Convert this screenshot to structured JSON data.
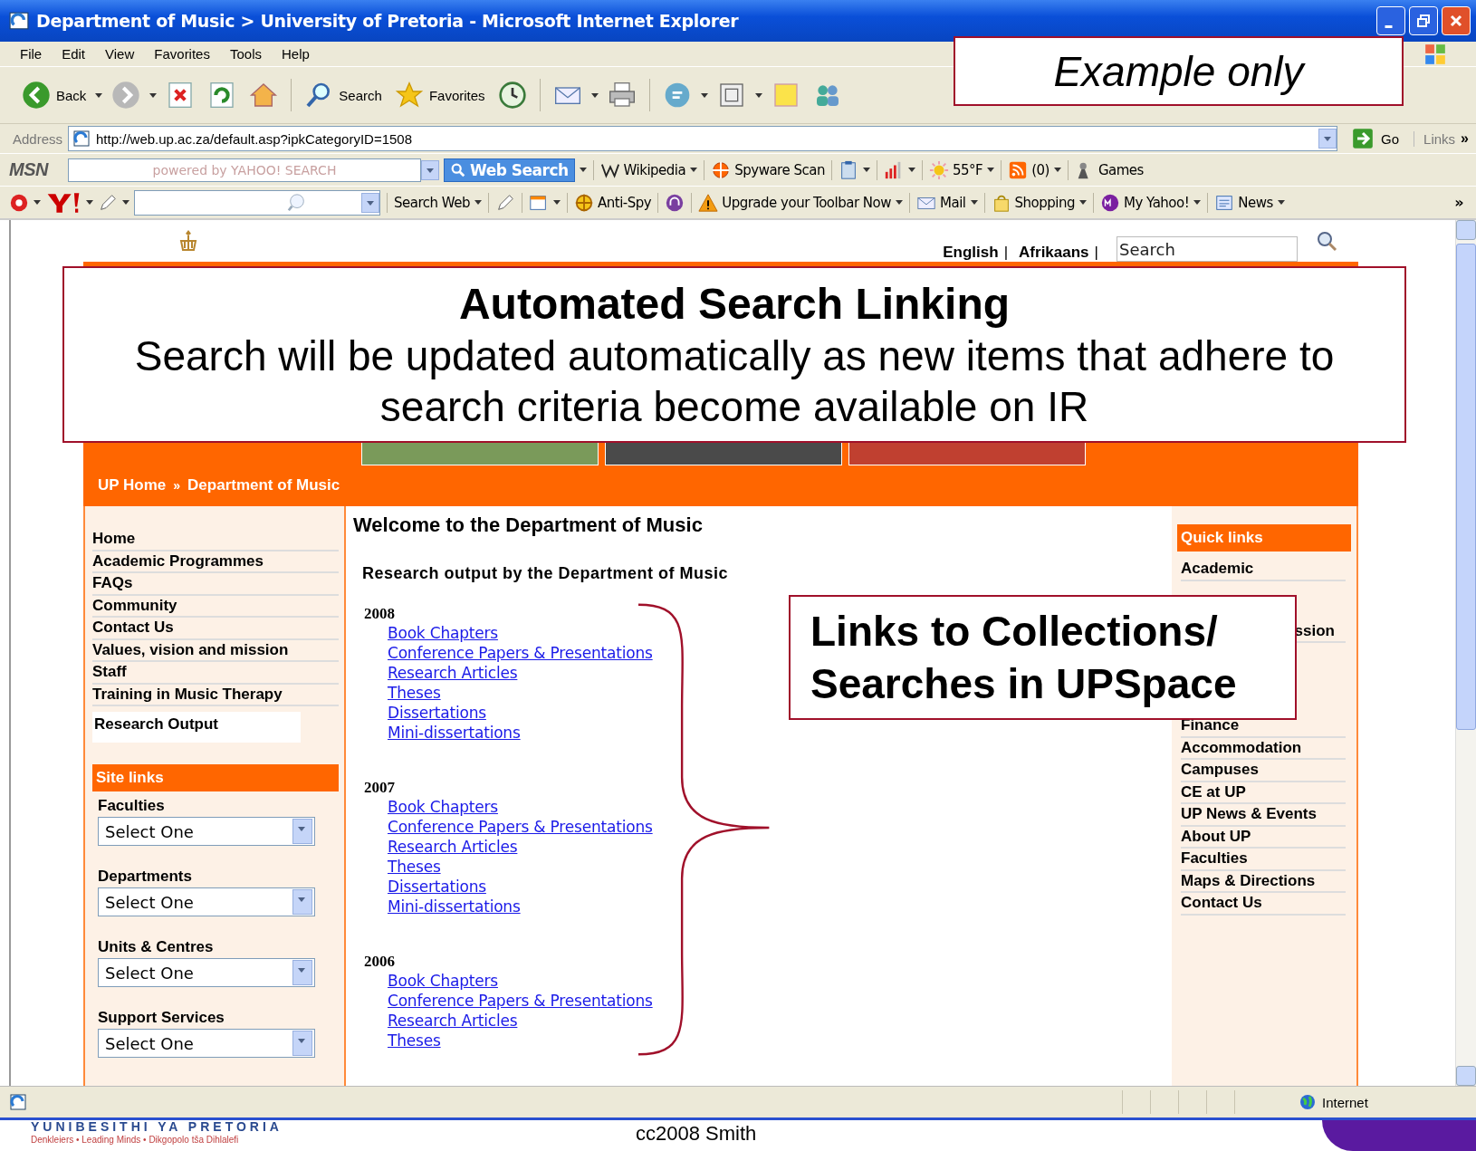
{
  "window": {
    "title": "Department of Music > University of Pretoria - Microsoft Internet Explorer"
  },
  "menu": [
    "File",
    "Edit",
    "View",
    "Favorites",
    "Tools",
    "Help"
  ],
  "toolbar": [
    {
      "kind": "back",
      "label": "Back",
      "dropdown": true
    },
    {
      "kind": "forward",
      "dropdown": true
    },
    {
      "kind": "stop"
    },
    {
      "kind": "refresh"
    },
    {
      "kind": "home"
    },
    {
      "kind": "search",
      "label": "Search"
    },
    {
      "kind": "favorites",
      "label": "Favorites"
    },
    {
      "kind": "history"
    },
    {
      "kind": "mail",
      "dropdown": true
    },
    {
      "kind": "print"
    },
    {
      "kind": "messenger",
      "dropdown": true
    },
    {
      "kind": "window",
      "dropdown": true
    },
    {
      "kind": "note"
    },
    {
      "kind": "people"
    }
  ],
  "address": {
    "label": "Address",
    "value": "http://web.up.ac.za/default.asp?ipkCategoryID=1508",
    "go": "Go",
    "links": "Links",
    "more": "»"
  },
  "msn_bar": {
    "logo": "MSN",
    "placeholder": "powered by YAHOO! SEARCH",
    "search_button": "Web Search",
    "items": [
      {
        "kind": "wiki",
        "label": "Wikipedia",
        "dropdown": true
      },
      {
        "kind": "spyware",
        "label": "Spyware Scan",
        "dropdown": false
      },
      {
        "kind": "clip",
        "dropdown": true
      },
      {
        "kind": "signal",
        "dropdown": true
      },
      {
        "kind": "weather",
        "label": "55°F",
        "dropdown": true
      },
      {
        "kind": "rss",
        "label": "(0)",
        "dropdown": true
      },
      {
        "kind": "games",
        "label": "Games",
        "dropdown": false
      }
    ]
  },
  "yahoo_bar": {
    "search_label": "Search Web",
    "items": [
      {
        "kind": "pencil",
        "dropdown": false
      },
      {
        "kind": "form",
        "dropdown": true
      },
      {
        "kind": "antispy",
        "label": "Anti-Spy",
        "dropdown": false
      },
      {
        "kind": "headphones",
        "dropdown": false
      },
      {
        "kind": "warning",
        "label": "Upgrade your Toolbar Now",
        "dropdown": true
      },
      {
        "kind": "mail",
        "label": "Mail",
        "dropdown": true
      },
      {
        "kind": "bag",
        "label": "Shopping",
        "dropdown": true
      },
      {
        "kind": "my",
        "label": "My Yahoo!",
        "dropdown": true
      },
      {
        "kind": "news",
        "label": "News",
        "dropdown": true
      }
    ],
    "more": "»"
  },
  "page": {
    "languages": [
      {
        "label": "English",
        "separator": "|"
      },
      {
        "label": "Afrikaans",
        "separator": "|"
      }
    ],
    "search_placeholder": "Search",
    "breadcrumb": [
      {
        "label": "UP Home"
      },
      {
        "label": "Department of Music"
      }
    ],
    "breadcrumb_separator": "»",
    "nav": [
      {
        "label": "Home",
        "selected": false
      },
      {
        "label": "Academic Programmes",
        "selected": false
      },
      {
        "label": "FAQs",
        "selected": false
      },
      {
        "label": "Community",
        "selected": false
      },
      {
        "label": "Contact Us",
        "selected": false
      },
      {
        "label": "Values, vision and mission",
        "selected": false
      },
      {
        "label": "Staff",
        "selected": false
      },
      {
        "label": "Training in Music Therapy",
        "selected": false
      },
      {
        "label": "Research Output",
        "selected": true
      }
    ],
    "site_links": {
      "title": "Site links",
      "selects": [
        {
          "label": "Faculties",
          "value": "Select One"
        },
        {
          "label": "Departments",
          "value": "Select One"
        },
        {
          "label": "Units & Centres",
          "value": "Select One"
        },
        {
          "label": "Support Services",
          "value": "Select One"
        }
      ]
    },
    "heading": "Welcome to the Department of Music",
    "subheading": "Research output by the Department of Music",
    "years": [
      {
        "year": "2008",
        "links": [
          "Book Chapters",
          "Conference Papers & Presentations",
          "Research Articles",
          "Theses",
          "Dissertations",
          "Mini-dissertations"
        ]
      },
      {
        "year": "2007",
        "links": [
          "Book Chapters",
          "Conference Papers & Presentations",
          "Research Articles",
          "Theses",
          "Dissertations",
          "Mini-dissertations"
        ]
      },
      {
        "year": "2006",
        "links": [
          "Book Chapters",
          "Conference Papers & Presentations",
          "Research Articles",
          "Theses"
        ]
      }
    ],
    "quick_links": {
      "title": "Quick links",
      "items": [
        {
          "kind": "partial",
          "label": "Academic"
        },
        {
          "kind": "fragment",
          "label": "ssion"
        },
        {
          "kind": "partial",
          "label": "Finance"
        },
        {
          "kind": "link",
          "label": "Accommodation"
        },
        {
          "kind": "link",
          "label": "Campuses"
        },
        {
          "kind": "link",
          "label": "CE at UP"
        },
        {
          "kind": "link",
          "label": "UP News & Events"
        },
        {
          "kind": "link",
          "label": "About UP"
        },
        {
          "kind": "link",
          "label": "Faculties"
        },
        {
          "kind": "link",
          "label": "Maps & Directions"
        },
        {
          "kind": "link",
          "label": "Contact Us"
        }
      ]
    }
  },
  "status_bar": {
    "zone": "Internet"
  },
  "slide": {
    "stamp": "Example only",
    "callout_top": {
      "title": "Automated Search Linking",
      "body": "Search will be updated automatically as new items that adhere to search criteria become available on IR"
    },
    "callout_links": "Links to Collections/ Searches in UPSpace",
    "footer": "cc2008 Smith",
    "logo_name": "YUNIBESITHI YA PRETORIA",
    "logo_tagline": "Denkleiers • Leading Minds • Dikgopolo tša Dihlalefi"
  }
}
